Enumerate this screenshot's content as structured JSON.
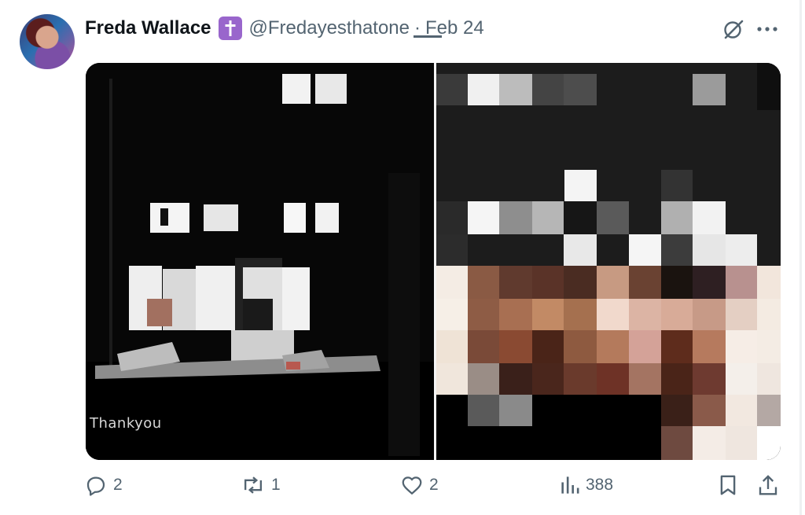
{
  "user": {
    "display_name": "Freda Wallace",
    "badge_icon": "cross-icon",
    "badge_color": "#9966cc",
    "handle": "@Fredayesthatone",
    "separator": "·",
    "date": "Feb 24"
  },
  "header_actions": {
    "grok_icon": "grok-icon",
    "more_icon": "more-dots-icon"
  },
  "media": {
    "left_image": {
      "caption_text": "Thankyou"
    },
    "right_image": {
      "description_icon": "pixelated-image"
    }
  },
  "actions": {
    "reply_count": "2",
    "repost_count": "1",
    "like_count": "2",
    "views_count": "388"
  },
  "colors": {
    "text": "#0f1419",
    "muted": "#536471",
    "accent_badge": "#9966cc"
  }
}
